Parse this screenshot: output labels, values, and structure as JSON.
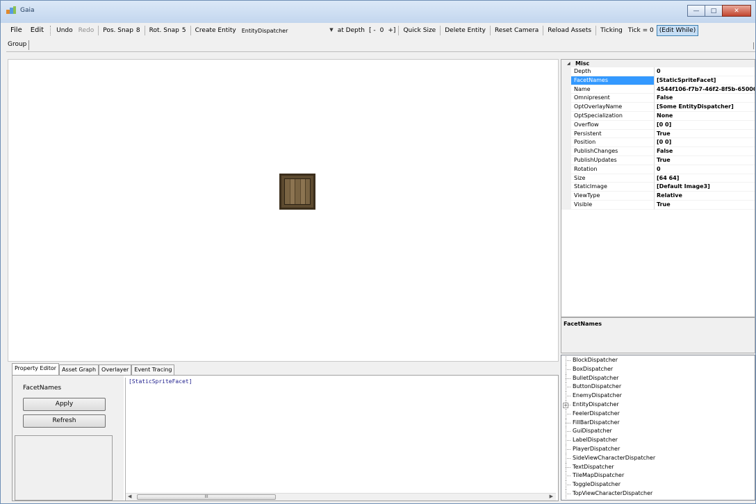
{
  "window": {
    "title": "Gaia"
  },
  "toolbar": {
    "file": "File",
    "edit": "Edit",
    "undo": "Undo",
    "redo": "Redo",
    "pos_snap": "Pos. Snap",
    "pos_snap_value": "8",
    "rot_snap": "Rot. Snap",
    "rot_snap_value": "5",
    "create_entity": "Create Entity",
    "entity_combo_value": "EntityDispatcher",
    "at_depth": "at Depth",
    "depth_dec": "[ -",
    "depth_value": "0",
    "depth_inc": "+]",
    "quick_size": "Quick Size",
    "delete_entity": "Delete Entity",
    "reset_camera": "Reset Camera",
    "reload_assets": "Reload Assets",
    "ticking": "Ticking",
    "tick_label": "Tick = 0",
    "edit_while": "(Edit While)"
  },
  "group_tab": "Group",
  "properties": {
    "category": "Misc",
    "rows": [
      {
        "name": "Depth",
        "value": "0"
      },
      {
        "name": "FacetNames",
        "value": "[StaticSpriteFacet]"
      },
      {
        "name": "Name",
        "value": "4544f106-f7b7-46f2-8f5b-65000"
      },
      {
        "name": "Omnipresent",
        "value": "False"
      },
      {
        "name": "OptOverlayName",
        "value": "[Some EntityDispatcher]"
      },
      {
        "name": "OptSpecialization",
        "value": "None"
      },
      {
        "name": "Overflow",
        "value": "[0 0]"
      },
      {
        "name": "Persistent",
        "value": "True"
      },
      {
        "name": "Position",
        "value": "[0 0]"
      },
      {
        "name": "PublishChanges",
        "value": "False"
      },
      {
        "name": "PublishUpdates",
        "value": "True"
      },
      {
        "name": "Rotation",
        "value": "0"
      },
      {
        "name": "Size",
        "value": "[64 64]"
      },
      {
        "name": "StaticImage",
        "value": "[Default Image3]"
      },
      {
        "name": "ViewType",
        "value": "Relative"
      },
      {
        "name": "Visible",
        "value": "True"
      }
    ],
    "selected_index": 1,
    "description_title": "FacetNames"
  },
  "dispatchers": [
    "BlockDispatcher",
    "BoxDispatcher",
    "BulletDispatcher",
    "ButtonDispatcher",
    "EnemyDispatcher",
    "EntityDispatcher",
    "FeelerDispatcher",
    "FillBarDispatcher",
    "GuiDispatcher",
    "LabelDispatcher",
    "PlayerDispatcher",
    "SideViewCharacterDispatcher",
    "TextDispatcher",
    "TileMapDispatcher",
    "ToggleDispatcher",
    "TopViewCharacterDispatcher"
  ],
  "expandable_dispatcher": "EntityDispatcher",
  "tabs": [
    "Property Editor",
    "Asset Graph",
    "Overlayer",
    "Event Tracing"
  ],
  "active_tab": 0,
  "property_editor": {
    "property_name": "FacetNames",
    "apply_label": "Apply",
    "refresh_label": "Refresh",
    "editor_text": "[StaticSpriteFacet]"
  },
  "scroll_thumb_grip": "III"
}
